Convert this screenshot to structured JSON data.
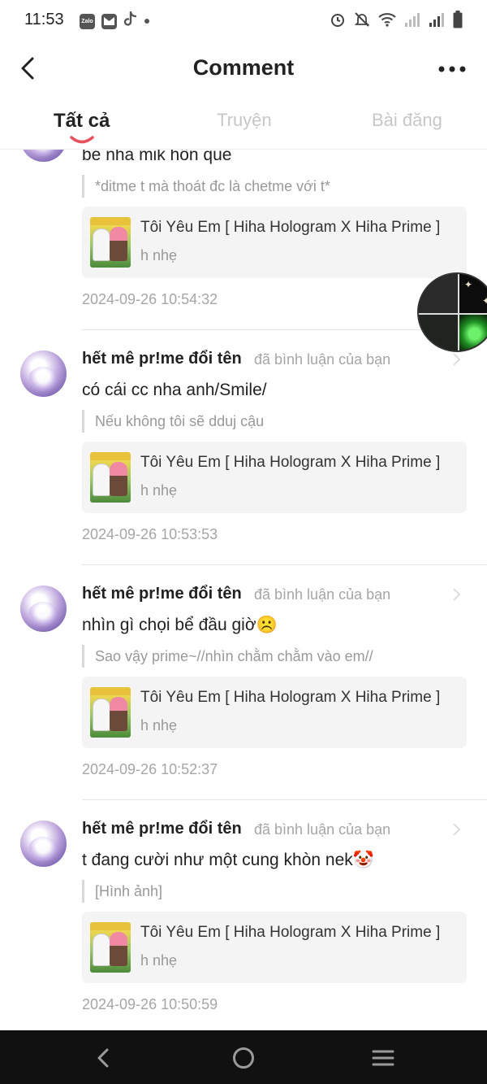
{
  "status_bar": {
    "time": "11:53",
    "notification_icons": [
      "zalo-icon",
      "mail-icon",
      "tiktok-icon",
      "more-dot-icon"
    ],
    "zalo_text": "Zalo",
    "system_icons": [
      "alarm-icon",
      "mute-icon",
      "wifi-icon",
      "signal-icon",
      "signal-icon",
      "battery-icon"
    ]
  },
  "header": {
    "title": "Comment",
    "back_icon": "back-arrow-icon",
    "more_icon": "more-dots-icon"
  },
  "tabs": [
    {
      "label": "Tất cả",
      "active": true
    },
    {
      "label": "Truyện",
      "active": false
    },
    {
      "label": "Bài đăng",
      "active": false
    }
  ],
  "accent_color": "#e8505b",
  "items": [
    {
      "comment": "bé nhà mik hôn qué",
      "quote": "*ditme t mà thoát đc là chetme với t*",
      "card_title": "Tôi Yêu Em [ Hiha Hologram X Hiha Prime ]",
      "card_sub": "h nhẹ",
      "time": "2024-09-26 10:54:32"
    },
    {
      "name": "hết mê pr!me đổi tên",
      "action": "đã bình luận của bạn",
      "comment": "có cái cc nha anh/Smile/",
      "quote": "Nếu không tôi sẽ dduj cậu",
      "card_title": "Tôi Yêu Em [ Hiha Hologram X Hiha Prime ]",
      "card_sub": "h nhẹ",
      "time": "2024-09-26 10:53:53"
    },
    {
      "name": "hết mê pr!me đổi tên",
      "action": "đã bình luận của bạn",
      "comment": "nhìn gì chọi bể đầu giờ☹️",
      "quote": "Sao vậy prime~//nhìn chằm chằm vào em//",
      "card_title": "Tôi Yêu Em [ Hiha Hologram X Hiha Prime ]",
      "card_sub": "h nhẹ",
      "time": "2024-09-26 10:52:37"
    },
    {
      "name": "hết mê pr!me đổi tên",
      "action": "đã bình luận của bạn",
      "comment": "t đang cười như một cung khòn nek🤡",
      "quote": "[Hình ảnh]",
      "card_title": "Tôi Yêu Em [ Hiha Hologram X Hiha Prime ]",
      "card_sub": "h nhẹ",
      "time": "2024-09-26 10:50:59"
    }
  ],
  "nav_bar": {
    "icons": [
      "nav-back-icon",
      "nav-home-icon",
      "nav-recents-icon"
    ]
  }
}
